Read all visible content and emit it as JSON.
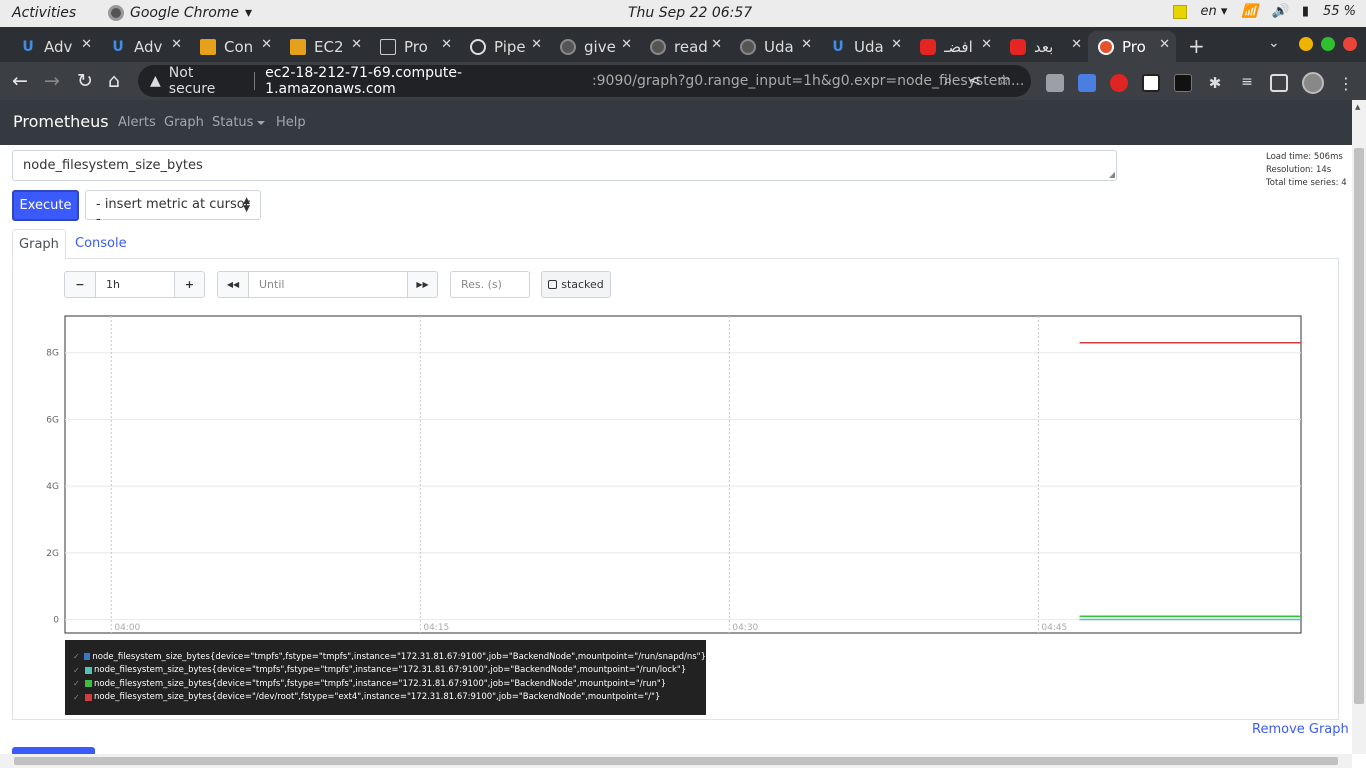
{
  "system": {
    "activities": "Activities",
    "app_menu": "Google Chrome",
    "clock": "Thu Sep 22  06:57",
    "language": "en",
    "battery": "55 %"
  },
  "browser": {
    "tabs": [
      {
        "label": "Adv",
        "icon": "udacity-icon"
      },
      {
        "label": "Adv",
        "icon": "udacity-icon"
      },
      {
        "label": "Con",
        "icon": "aws-box-icon"
      },
      {
        "label": "EC2",
        "icon": "aws-box-icon"
      },
      {
        "label": "Pro",
        "icon": "page-icon"
      },
      {
        "label": "Pipe",
        "icon": "circleci-icon"
      },
      {
        "label": "give",
        "icon": "github-icon"
      },
      {
        "label": "read",
        "icon": "github-icon"
      },
      {
        "label": "Uda",
        "icon": "github-icon"
      },
      {
        "label": "Uda",
        "icon": "udacity-icon"
      },
      {
        "label": "افضـ",
        "icon": "youtube-icon"
      },
      {
        "label": "بعد",
        "icon": "youtube-icon"
      },
      {
        "label": "Pro",
        "icon": "prometheus-icon"
      }
    ],
    "not_secure": "Not secure",
    "url_host": "ec2-18-212-71-69.compute-1.amazonaws.com",
    "url_path": ":9090/graph?g0.range_input=1h&g0.expr=node_filesystem..."
  },
  "prometheus": {
    "brand": "Prometheus",
    "nav": {
      "alerts": "Alerts",
      "graph": "Graph",
      "status": "Status",
      "help": "Help"
    },
    "expression": "node_filesystem_size_bytes",
    "stats": {
      "load_time": "Load time: 506ms",
      "resolution": "Resolution: 14s",
      "total_series": "Total time series: 4"
    },
    "execute": "Execute",
    "insert_metric": "- insert metric at cursor -",
    "tabs": {
      "graph": "Graph",
      "console": "Console"
    },
    "controls": {
      "minus": "−",
      "range": "1h",
      "plus": "+",
      "back": "◀◀",
      "until_placeholder": "Until",
      "forward": "▶▶",
      "res_placeholder": "Res. (s)",
      "stacked": "stacked"
    },
    "legend": [
      {
        "color": "#3b78c4",
        "label": "node_filesystem_size_bytes{device=\"tmpfs\",fstype=\"tmpfs\",instance=\"172.31.81.67:9100\",job=\"BackendNode\",mountpoint=\"/run/snapd/ns\"}"
      },
      {
        "color": "#4fc4b8",
        "label": "node_filesystem_size_bytes{device=\"tmpfs\",fstype=\"tmpfs\",instance=\"172.31.81.67:9100\",job=\"BackendNode\",mountpoint=\"/run/lock\"}"
      },
      {
        "color": "#3fbf3f",
        "label": "node_filesystem_size_bytes{device=\"tmpfs\",fstype=\"tmpfs\",instance=\"172.31.81.67:9100\",job=\"BackendNode\",mountpoint=\"/run\"}"
      },
      {
        "color": "#d23c3c",
        "label": "node_filesystem_size_bytes{device=\"/dev/root\",fstype=\"ext4\",instance=\"172.31.81.67:9100\",job=\"BackendNode\",mountpoint=\"/\"}"
      }
    ],
    "remove_graph": "Remove Graph"
  },
  "chart_data": {
    "type": "line",
    "y_ticks": [
      "0",
      "2G",
      "4G",
      "6G",
      "8G"
    ],
    "x_ticks": [
      "04:00",
      "04:15",
      "04:30",
      "04:45"
    ],
    "ylim": [
      -0.4,
      9.1
    ],
    "xlim": [
      "03:57:45",
      "04:57:45"
    ],
    "grid": true,
    "series": [
      {
        "name": "node_filesystem_size_bytes{device=\"tmpfs\",fstype=\"tmpfs\",instance=\"172.31.81.67:9100\",job=\"BackendNode\",mountpoint=\"/run/snapd/ns\"}",
        "color": "#3b78c4",
        "x": [
          "04:47",
          "04:57:45"
        ],
        "y": [
          0.1,
          0.1
        ]
      },
      {
        "name": "node_filesystem_size_bytes{device=\"tmpfs\",fstype=\"tmpfs\",instance=\"172.31.81.67:9100\",job=\"BackendNode\",mountpoint=\"/run/lock\"}",
        "color": "#4fc4b8",
        "x": [
          "04:47",
          "04:57:45"
        ],
        "y": [
          0.005,
          0.005
        ]
      },
      {
        "name": "node_filesystem_size_bytes{device=\"tmpfs\",fstype=\"tmpfs\",instance=\"172.31.81.67:9100\",job=\"BackendNode\",mountpoint=\"/run\"}",
        "color": "#3fbf3f",
        "x": [
          "04:47",
          "04:57:45"
        ],
        "y": [
          0.1,
          0.1
        ]
      },
      {
        "name": "node_filesystem_size_bytes{device=\"/dev/root\",fstype=\"ext4\",instance=\"172.31.81.67:9100\",job=\"BackendNode\",mountpoint=\"/\"}",
        "color": "#d23c3c",
        "x": [
          "04:47",
          "04:57:45"
        ],
        "y": [
          8.3,
          8.3
        ]
      }
    ]
  }
}
